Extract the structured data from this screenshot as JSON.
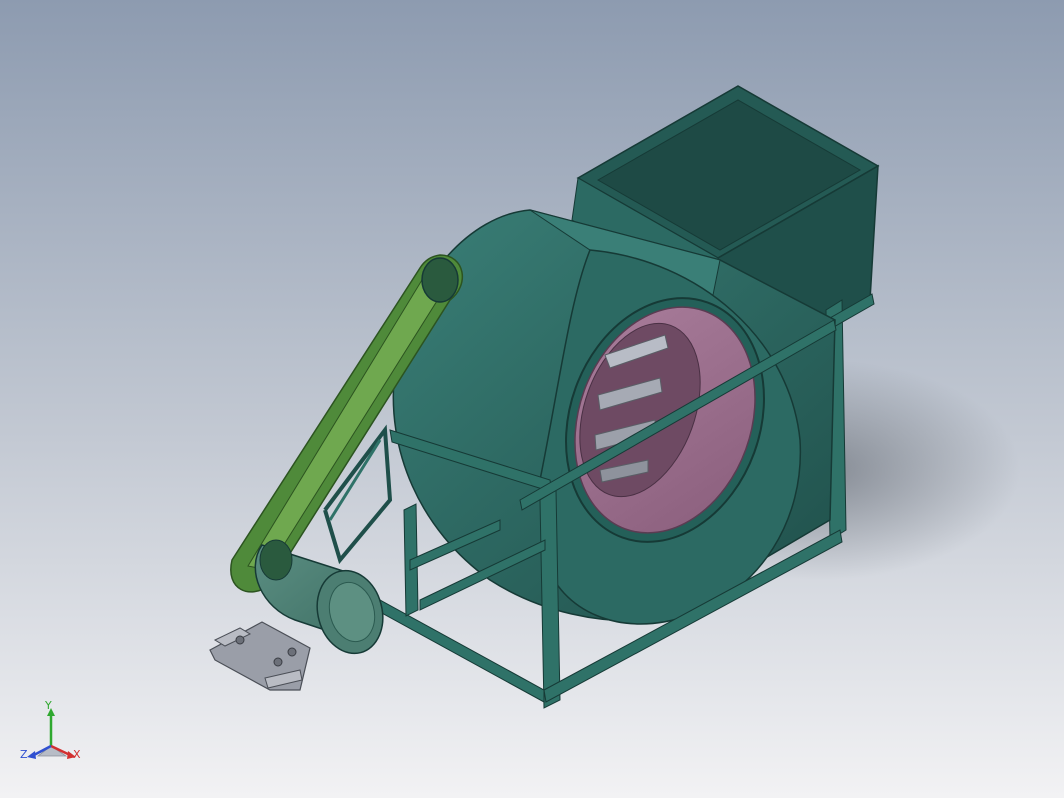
{
  "viewport": {
    "background_top": "#8d9bb0",
    "background_mid": "#c3c9d3",
    "background_bottom": "#f2f2f4"
  },
  "model": {
    "housing_color": "#2c6a63",
    "housing_light": "#3a7f77",
    "housing_dark": "#1f4f4a",
    "frame_color": "#2f7268",
    "inlet_color": "#8a5e7c",
    "inlet_light": "#a97d9b",
    "belt_color": "#4f8a3a",
    "belt_light": "#6fa84f",
    "motor_color": "#3d6e63",
    "motor_light": "#5b8e82",
    "base_color": "#9a9ea8",
    "shadow_color": "#7f858e"
  },
  "triad": {
    "x_label": "X",
    "y_label": "Y",
    "z_label": "Z",
    "x_color": "#d23030",
    "y_color": "#2fa82f",
    "z_color": "#3050d0"
  }
}
